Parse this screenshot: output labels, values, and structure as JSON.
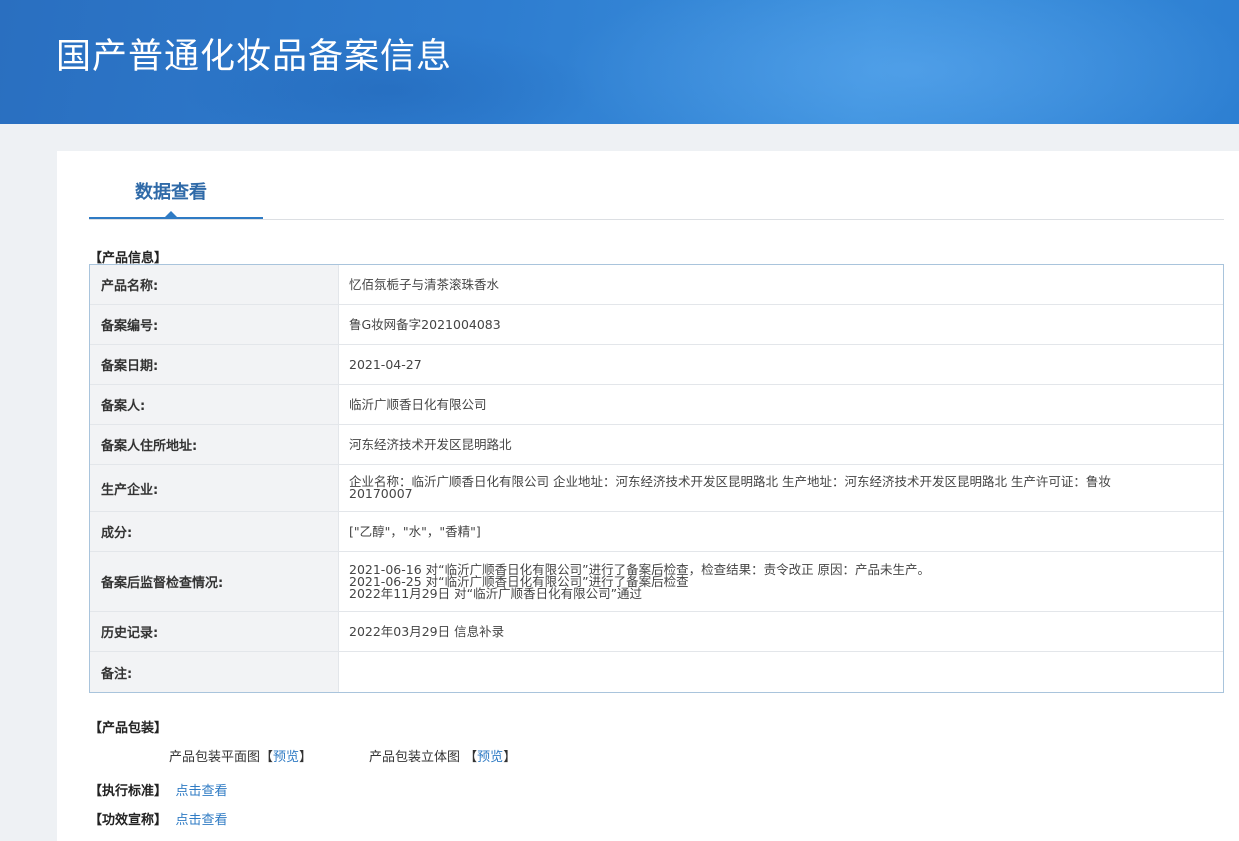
{
  "banner": {
    "title": "国产普通化妆品备案信息"
  },
  "tabs": [
    {
      "label": "数据查看"
    }
  ],
  "product_info": {
    "section_title": "【产品信息】",
    "rows": [
      {
        "label": "产品名称:",
        "value": "忆佰氛栀子与清茶滚珠香水"
      },
      {
        "label": "备案编号:",
        "value": "鲁G妆网备字2021004083"
      },
      {
        "label": "备案日期:",
        "value": "2021-04-27"
      },
      {
        "label": "备案人:",
        "value": "临沂广顺香日化有限公司"
      },
      {
        "label": "备案人住所地址:",
        "value": "河东经济技术开发区昆明路北"
      },
      {
        "label": "生产企业:",
        "lines": [
          "企业名称：临沂广顺香日化有限公司 企业地址：河东经济技术开发区昆明路北 生产地址：河东经济技术开发区昆明路北 生产许可证：鲁妆",
          "20170007"
        ]
      },
      {
        "label": "成分:",
        "value": "[\"乙醇\"，\"水\"，\"香精\"]"
      },
      {
        "label": "备案后监督检查情况:",
        "lines": [
          "2021-06-16 对“临沂广顺香日化有限公司”进行了备案后检查，检查结果：责令改正 原因：产品未生产。",
          "2021-06-25 对“临沂广顺香日化有限公司”进行了备案后检查",
          "2022年11月29日 对“临沂广顺香日化有限公司”通过"
        ]
      },
      {
        "label": "历史记录:",
        "value": "2022年03月29日 信息补录"
      },
      {
        "label": "备注:",
        "value": ""
      }
    ]
  },
  "packaging": {
    "section_title": "【产品包装】",
    "flat_label": "产品包装平面图",
    "flat_bracket_open": "【",
    "flat_link": "预览",
    "flat_bracket_close": "】",
    "stereo_label": "产品包装立体图",
    "stereo_bracket_open": "【",
    "stereo_link": "预览",
    "stereo_bracket_close": "】"
  },
  "standard": {
    "section_title": "【执行标准】",
    "link": "点击查看"
  },
  "efficacy": {
    "section_title": "【功效宣称】",
    "link": "点击查看"
  }
}
